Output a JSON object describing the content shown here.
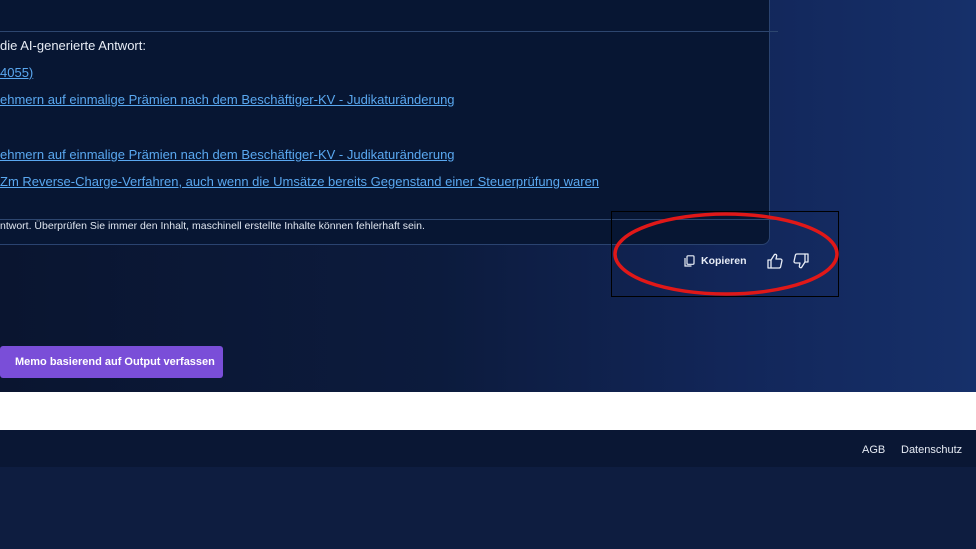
{
  "answer": {
    "sources_heading": "die AI-generierte Antwort:",
    "links": [
      "4055)",
      "ehmern auf einmalige Prämien nach dem Beschäftiger-KV - Judikaturänderung",
      "ehmern auf einmalige Prämien nach dem Beschäftiger-KV - Judikaturänderung",
      "Zm Reverse-Charge-Verfahren, auch wenn die Umsätze bereits Gegenstand einer Steuerprüfung waren"
    ],
    "disclaimer": "ntwort. Überprüfen Sie immer den Inhalt, maschinell erstellte Inhalte können fehlerhaft sein."
  },
  "actions": {
    "copy_label": "Kopieren",
    "copy_icon": "copy-icon",
    "thumbs_up_icon": "thumbs-up-icon",
    "thumbs_down_icon": "thumbs-down-icon",
    "highlight_color": "#e01818"
  },
  "memo_button": {
    "label": "Memo basierend auf Output verfassen",
    "color": "#7a4ed8"
  },
  "footer": {
    "links": [
      "AGB",
      "Datenschutz"
    ]
  }
}
